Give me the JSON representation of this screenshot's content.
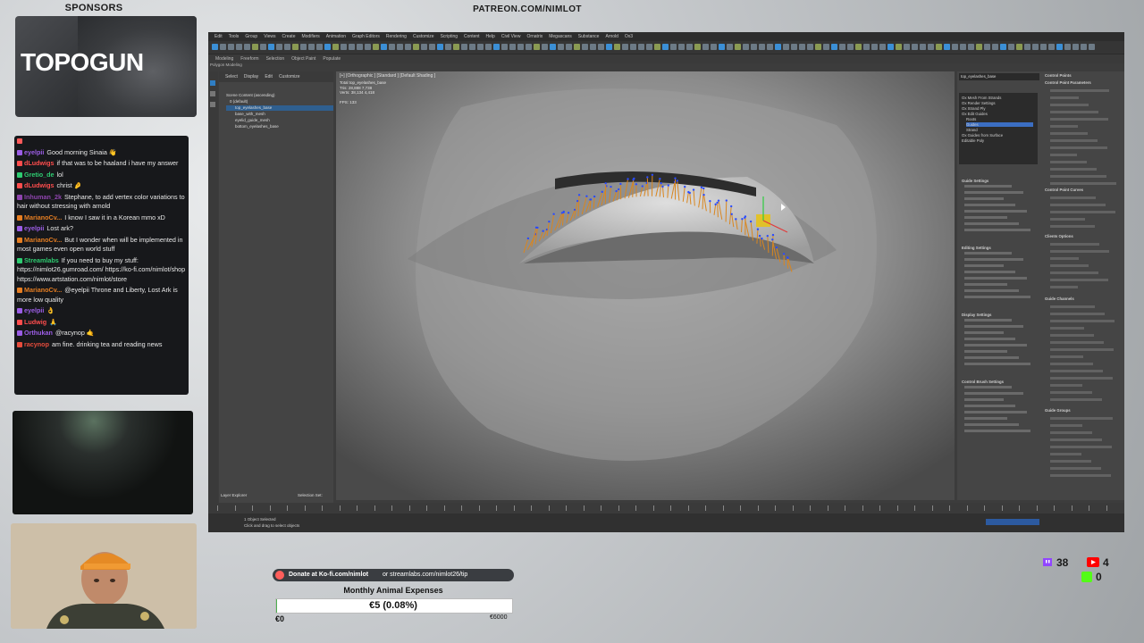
{
  "overlay": {
    "sponsors_label": "SPONSORS",
    "patreon_url": "PATREON.COM/NIMLOT",
    "sponsor_logo": "TOPOGUN"
  },
  "chat": [
    {
      "user": "",
      "message": "",
      "color": "#ff5a5a"
    },
    {
      "user": "eyelpii",
      "message": "Good morning Sinaia 👋",
      "color": "#9b5de5"
    },
    {
      "user": "dLudwigs",
      "message": "if that was to be haaland i have my answer",
      "color": "#ff4d4d"
    },
    {
      "user": "Gretio_de",
      "message": "lol",
      "color": "#2ecc71"
    },
    {
      "user": "dLudwigs",
      "message": "christ 🤌",
      "color": "#ff4d4d"
    },
    {
      "user": "Inhuman_2k",
      "message": "Stephane, to add vertex color variations to hair without stressing with arnold",
      "color": "#8e44ad"
    },
    {
      "user": "MarianoCv...",
      "message": "I know I saw it in a Korean mmo xD",
      "color": "#e67e22"
    },
    {
      "user": "eyelpii",
      "message": "Lost ark?",
      "color": "#9b5de5"
    },
    {
      "user": "MarianoCv...",
      "message": "But I wonder when will be implemented in most games even open world stuff",
      "color": "#e67e22"
    },
    {
      "user": "Streamlabs",
      "message": "If you need to buy my stuff: https://nimlot26.gumroad.com/ https://ko-fi.com/nimlot/shop https://www.artstation.com/nimlot/store",
      "color": "#2ecc71"
    },
    {
      "user": "MarianoCv...",
      "message": "@eyelpii Throne and Liberty, Lost Ark is more low quality",
      "color": "#e67e22"
    },
    {
      "user": "eyelpii",
      "message": "👌",
      "color": "#9b5de5"
    },
    {
      "user": "Ludwig",
      "message": "🙏",
      "color": "#ff4d4d"
    },
    {
      "user": "Orthukan",
      "message": "@racynop 🤙",
      "color": "#9b5de5"
    },
    {
      "user": "racynop",
      "message": "am fine. drinking tea and reading news",
      "color": "#e74c3c"
    }
  ],
  "app": {
    "menu": [
      "Edit",
      "Tools",
      "Group",
      "Views",
      "Create",
      "Modifiers",
      "Animation",
      "Graph Editors",
      "Rendering",
      "Customize",
      "Scripting",
      "Content",
      "Help",
      "Civil View",
      "Ornatrix",
      "Megascans",
      "Substance",
      "Arnold",
      "Ox3"
    ],
    "ribbon": [
      "Modeling",
      "Freeform",
      "Selection",
      "Object Paint",
      "Populate"
    ],
    "ribbon_sub": "Polygon Modeling",
    "explorer_tabs": [
      "Select",
      "Display",
      "Edit",
      "Customize"
    ],
    "explorer_items": [
      "Scene Content (ascending)",
      "0 (default)",
      "top_eyelashes_base",
      "base_with_mesh",
      "eyelid_guide_mesh",
      "bottom_eyelashes_base"
    ],
    "viewport_label": "[+] [Orthographic ] [Standard ] [Default Shading ]",
    "viewport_stats": [
      "Total    top_eyelashes_base",
      "Tris:  28,888   7,738",
      "Verts: 38,134   4,418",
      "",
      "FPS: 133"
    ],
    "modifier_name": "top_eyelashes_base",
    "modifier_list": [
      "Ox Mesh From Strands",
      "Ox Render Settings",
      "Ox Strand Ply",
      "Ox Edit Guides",
      "Roots",
      "Guides",
      "Strand",
      "Ox Guides from Surface",
      "Editable Poly"
    ],
    "panel_sections": [
      "Guide Settings",
      "Editing Settings",
      "Display Settings",
      "Control Brush Settings"
    ],
    "right_sections": [
      "Control Points",
      "Control Point Parameters",
      "Control Point Curves",
      "Clients Options",
      "Guide Channels",
      "Guide Groups"
    ],
    "status_text": "1 Object Selected",
    "status_hint": "Click and drag to select objects",
    "layer_explorer": "Layer Explorer",
    "selection_set": "Selection Set:"
  },
  "donation": {
    "kofi_text": "Donate at Ko-fi.com/nimlot",
    "or_text": "or streamlabs.com/nimlot26/tip",
    "goal_title": "Monthly Animal Expenses",
    "goal_value": "€5 (0.08%)",
    "goal_min": "€0",
    "goal_max": "€6000",
    "goal_fraction": 0.0008
  },
  "stream_stats": {
    "twitch_count": "38",
    "youtube_count": "4",
    "other_count": "0"
  },
  "colors": {
    "twitch": "#9146ff",
    "youtube": "#ff0000",
    "kofi": "#ff5e5b",
    "viewport_bg": "#777777",
    "guide_orange": "#d9861f",
    "guide_blue": "#2a4cff"
  }
}
